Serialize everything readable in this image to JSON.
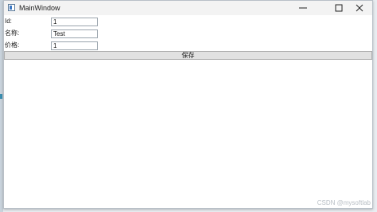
{
  "window": {
    "title": "MainWindow",
    "controls": {
      "minimize_icon": "minimize-icon",
      "maximize_icon": "maximize-icon",
      "close_icon": "close-icon"
    }
  },
  "form": {
    "id": {
      "label": "Id:",
      "value": "1"
    },
    "name": {
      "label": "名称:",
      "value": "Test"
    },
    "price": {
      "label": "价格:",
      "value": "1"
    }
  },
  "actions": {
    "save_label": "保存"
  },
  "watermark": "CSDN @mysoftlab",
  "colors": {
    "button_face": "#e1e1e1",
    "titlebar": "#f3f3f3",
    "input_border": "#9aa4ad"
  }
}
